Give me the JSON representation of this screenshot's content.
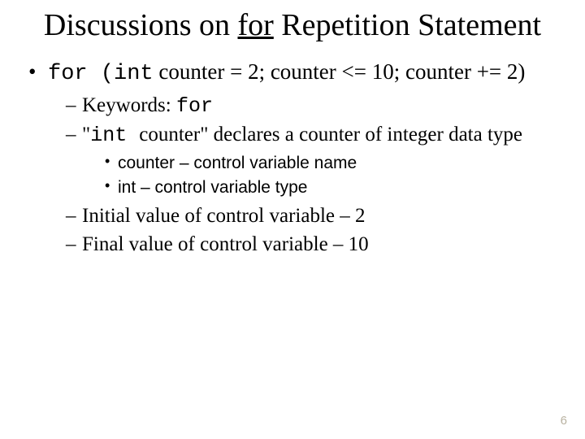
{
  "title": {
    "pre": "Discussions on ",
    "kw": "for",
    "post": " Repetition Statement"
  },
  "main_bullet": {
    "a": "for (int",
    "b": " counter = 2;  counter <= 10; counter += 2)"
  },
  "lvl2": {
    "keywords_label": "Keywords: ",
    "keywords_kw": "for",
    "decl_a": "\"",
    "decl_b": "int ",
    "decl_c": "counter\" declares a counter of integer data type",
    "initial": "Initial value of control variable – 2",
    "final": "Final value of control variable – 10"
  },
  "lvl3": {
    "name": "counter – control variable name",
    "type": "int – control variable type"
  },
  "page_number": "6"
}
